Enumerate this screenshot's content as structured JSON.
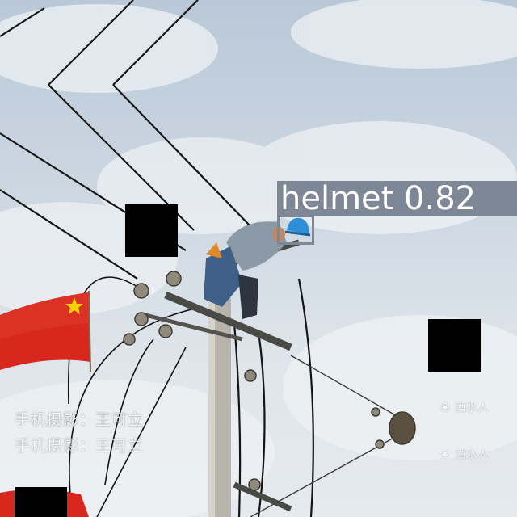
{
  "detection": {
    "label": "helmet 0.82",
    "class": "helmet",
    "confidence": 0.82,
    "box_color": "#7d8796",
    "label_text_color": "#ffffff"
  },
  "overlay_captions": [
    "手机摄影：王可立",
    "手机摄影：王可立"
  ],
  "watermarks": [
    {
      "icon": "wechat-icon",
      "text": "酒水人"
    },
    {
      "icon": "wechat-icon",
      "text": "酒水人"
    }
  ],
  "colors": {
    "sky": "#cbd6e1",
    "flag_red": "#d8271d",
    "flag_star": "#f5d300",
    "helmet_blue": "#2f8fd6",
    "wire": "#141414",
    "privacy_mask": "#000000"
  }
}
